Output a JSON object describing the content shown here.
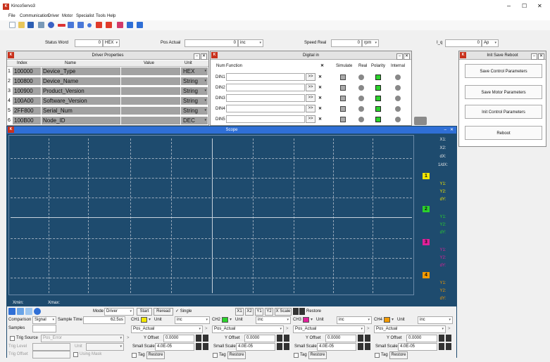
{
  "app": {
    "title": "KincoServo3",
    "window_controls": [
      "–",
      "☐",
      "✕"
    ]
  },
  "menu": [
    "File",
    "Communication",
    "Driver",
    "Motor",
    "Specialist",
    "Tools",
    "Help"
  ],
  "toolbar_icons": [
    "new-icon",
    "open-icon",
    "save-icon",
    "tools-icon",
    "connect-icon",
    "disconnect-icon",
    "read-icon",
    "write-icon",
    "record-icon",
    "upload-icon",
    "download-icon",
    "parameter-icon",
    "scope-icon",
    "help-icon"
  ],
  "status": {
    "status_word_label": "Status Word",
    "status_word_value": "0",
    "status_word_unit": "HEX",
    "pos_actual_label": "Pos Actual",
    "pos_actual_value": "0",
    "pos_actual_unit": "inc",
    "speed_real_label": "Speed Real",
    "speed_real_value": "0",
    "speed_real_unit": "rpm",
    "iq_label": "I_q",
    "iq_value": "0",
    "iq_unit": "Ap"
  },
  "driver_props": {
    "title": "Driver Properties",
    "headers": [
      "Index",
      "Name",
      "Value",
      "Unit"
    ],
    "rows": [
      {
        "n": "1",
        "index": "100000",
        "name": "Device_Type",
        "value": "",
        "unit": "HEX"
      },
      {
        "n": "2",
        "index": "100800",
        "name": "Device_Name",
        "value": "",
        "unit": "String"
      },
      {
        "n": "3",
        "index": "100900",
        "name": "Product_Version",
        "value": "",
        "unit": "String"
      },
      {
        "n": "4",
        "index": "100A00",
        "name": "Software_Version",
        "value": "",
        "unit": "String"
      },
      {
        "n": "5",
        "index": "2FF800",
        "name": "Serial_Num",
        "value": "",
        "unit": "String"
      },
      {
        "n": "6",
        "index": "100B00",
        "name": "Node_ID",
        "value": "",
        "unit": "DEC"
      }
    ]
  },
  "digital_in": {
    "title": "Digital in",
    "headers": [
      "Num",
      "Function",
      "Simulate",
      "Real",
      "Polarity",
      "Internal"
    ],
    "rows": [
      {
        "num": "DIN1",
        "btn": ">>"
      },
      {
        "num": "DIN2",
        "btn": ">>"
      },
      {
        "num": "DIN3",
        "btn": ">>"
      },
      {
        "num": "DIN4",
        "btn": ">>"
      },
      {
        "num": "DIN5",
        "btn": ">>"
      }
    ]
  },
  "init_save": {
    "title": "Init Save Reboot",
    "buttons": [
      "Save Control Parameters",
      "Save Motor Parameters",
      "Init Control Parameters",
      "Reboot"
    ]
  },
  "scope": {
    "title": "Scope",
    "xmin_label": "Xmin:",
    "xmax_label": "Xmax:",
    "side": {
      "x_labels": [
        "X1:",
        "X2:",
        "dX:",
        "1/dX:"
      ],
      "channels": [
        {
          "num": "1",
          "color": "#f2e600",
          "labels": [
            "Y1:",
            "Y2:",
            "dY:"
          ]
        },
        {
          "num": "2",
          "color": "#2bd22b",
          "labels": [
            "Y1:",
            "Y2:",
            "dY:"
          ]
        },
        {
          "num": "3",
          "color": "#e0209a",
          "labels": [
            "Y1:",
            "Y2:",
            "dY:"
          ]
        },
        {
          "num": "4",
          "color": "#f29a00",
          "labels": [
            "Y1:",
            "Y2:",
            "dY:"
          ]
        }
      ]
    },
    "controls": {
      "mode_label": "Mode",
      "mode_value": "Driver",
      "start": "Start",
      "reread": "Reread",
      "single": "Single",
      "cursor_buttons": [
        "X1",
        "X2",
        "Y1",
        "Y2",
        "X Scale"
      ],
      "restore": "Restore",
      "comparison_label": "Comparison",
      "comparison_value": "Signal",
      "sample_time_label": "Sample Time",
      "sample_time_value": "62.5us",
      "samples_label": "Samples",
      "samples_value": "",
      "trig_source_label": "Trig Source",
      "trig_source_value": "Pos_Error",
      "trig_level_label": "Trig Level",
      "unit_label": "Unit",
      "trig_offset_label": "Trig Offset",
      "using_mask": "Using Mask"
    },
    "channels": [
      {
        "name": "CH1",
        "color": "#f2e600",
        "unit_label": "Unit",
        "unit": "inc",
        "object": "Pos_Actual",
        "yoffset_label": "Y Offset",
        "yoffset": "0.0000",
        "scale_label": "Small Scale",
        "scale": "4.0E-05",
        "tag": "Tag",
        "restore": "Restore"
      },
      {
        "name": "CH2",
        "color": "#2bd22b",
        "unit_label": "Unit",
        "unit": "inc",
        "object": "Pos_Actual",
        "yoffset_label": "Y Offset",
        "yoffset": "0.0000",
        "scale_label": "Small Scale",
        "scale": "4.0E-05",
        "tag": "Tag",
        "restore": "Restore"
      },
      {
        "name": "CH3",
        "color": "#e0209a",
        "unit_label": "Unit",
        "unit": "inc",
        "object": "Pos_Actual",
        "yoffset_label": "Y Offset",
        "yoffset": "0.0000",
        "scale_label": "Small Scale",
        "scale": "4.0E-05",
        "tag": "Tag",
        "restore": "Restore"
      },
      {
        "name": "CH4",
        "color": "#f29a00",
        "unit_label": "Unit",
        "unit": "inc",
        "object": "Pos_Actual",
        "yoffset_label": "Y Offset",
        "yoffset": "0.0000",
        "scale_label": "Small Scale",
        "scale": "4.0E-05",
        "tag": "Tag",
        "restore": "Restore"
      }
    ]
  },
  "colors": {
    "scope_bg": "#1e4b6e",
    "accent": "#2f6fd6",
    "kinco_red": "#c8311c",
    "row_grey": "#a2a2a2"
  }
}
